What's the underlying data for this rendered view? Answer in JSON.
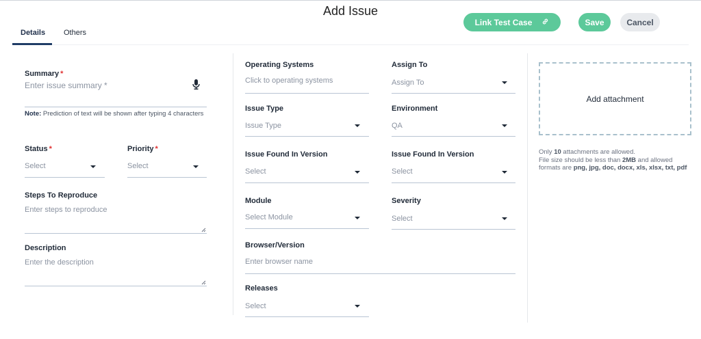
{
  "dialog": {
    "title": "Add Issue"
  },
  "tabs": [
    {
      "label": "Details",
      "active": true
    },
    {
      "label": "Others",
      "active": false
    }
  ],
  "actions": {
    "link_test_case": "Link Test Case",
    "save": "Save",
    "cancel": "Cancel"
  },
  "form": {
    "summary": {
      "label": "Summary",
      "placeholder": "Enter issue summary *"
    },
    "note": {
      "prefix": "Note:",
      "text": "Prediction of text will be shown after typing 4 characters"
    },
    "status": {
      "label": "Status",
      "value": "Select"
    },
    "priority": {
      "label": "Priority",
      "value": "Select"
    },
    "steps": {
      "label": "Steps To Reproduce",
      "placeholder": "Enter steps to reproduce"
    },
    "description": {
      "label": "Description",
      "placeholder": "Enter the description"
    },
    "operating_systems": {
      "label": "Operating Systems",
      "placeholder": "Click to operating systems"
    },
    "assign_to": {
      "label": "Assign To",
      "value": "Assign To"
    },
    "issue_type": {
      "label": "Issue Type",
      "value": "Issue Type"
    },
    "environment": {
      "label": "Environment",
      "value": "QA"
    },
    "found_version_1": {
      "label": "Issue Found In Version",
      "value": "Select"
    },
    "found_version_2": {
      "label": "Issue Found In Version",
      "value": "Select"
    },
    "module": {
      "label": "Module",
      "value": "Select Module"
    },
    "severity": {
      "label": "Severity",
      "value": "Select"
    },
    "browser": {
      "label": "Browser/Version",
      "placeholder": "Enter browser name"
    },
    "releases": {
      "label": "Releases",
      "value": "Select"
    }
  },
  "attachment": {
    "label": "Add attachment",
    "info_line1_pre": "Only ",
    "info_count": "10",
    "info_line1_post": " attachments are allowed.",
    "info_line2_pre": "File size should be less than ",
    "info_size": "2MB",
    "info_line2_post": " and allowed",
    "info_line3_pre": "formats are ",
    "info_formats": "png, jpg, doc, docx, xls, xlsx, txt, pdf"
  },
  "colors": {
    "accent_green": "#5cc99a",
    "required": "#e03131",
    "tab_underline": "#1f3c66"
  }
}
